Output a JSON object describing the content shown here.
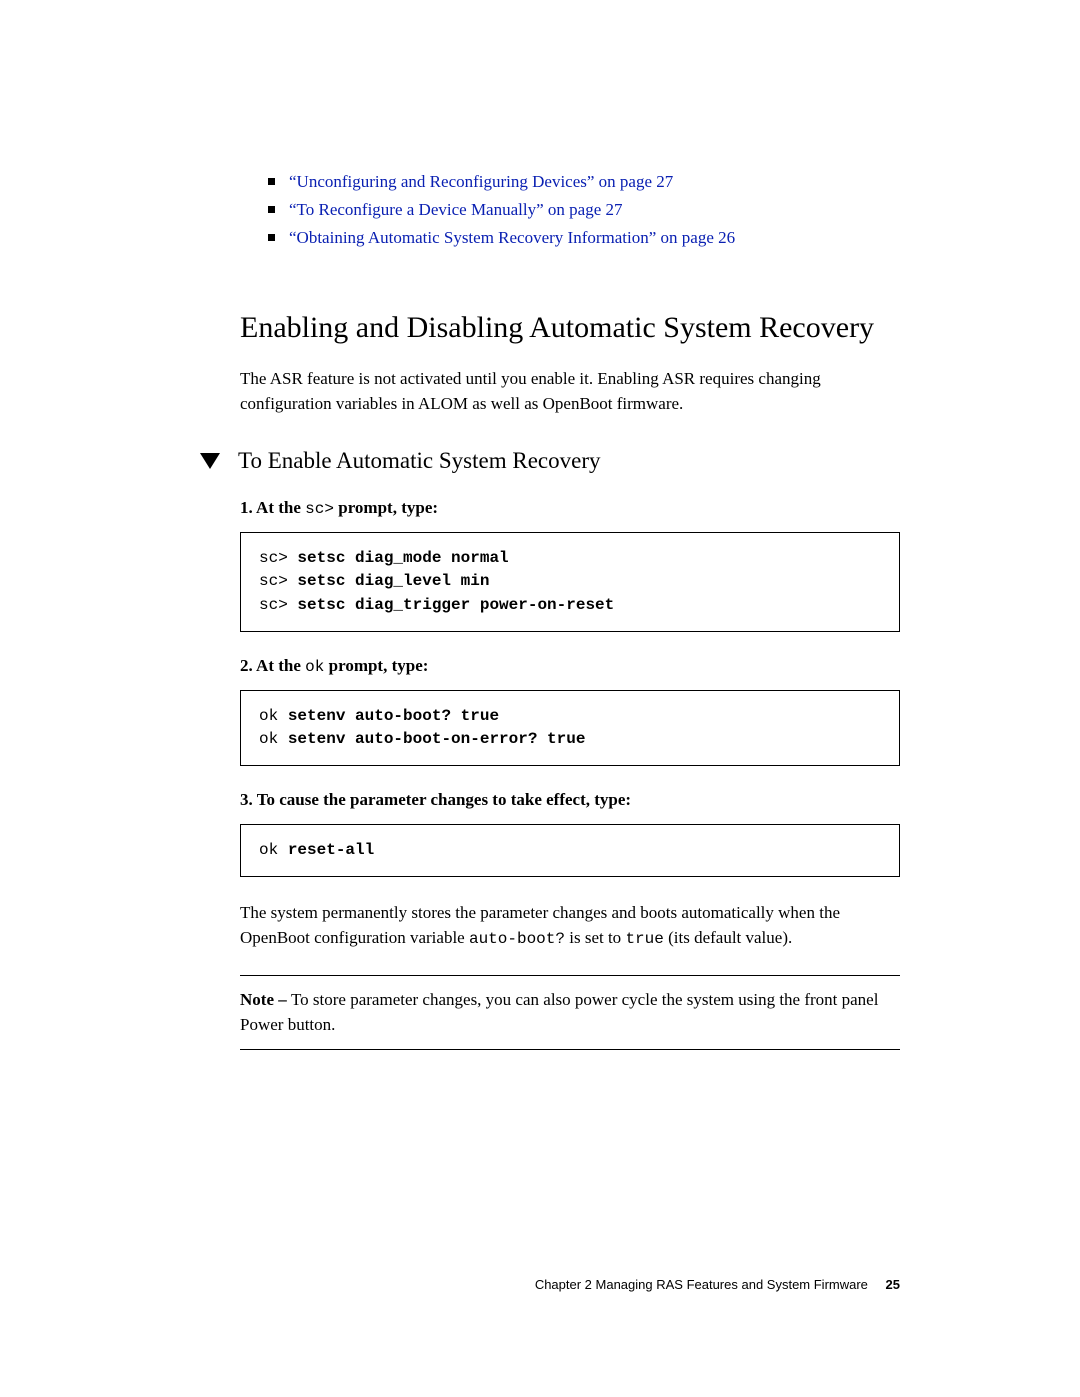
{
  "links": [
    {
      "text": "“Unconfiguring and Reconfiguring Devices” on page 27"
    },
    {
      "text": "“To Reconfigure a Device Manually” on page 27"
    },
    {
      "text": "“Obtaining Automatic System Recovery Information” on page 26"
    }
  ],
  "section": {
    "heading": "Enabling and Disabling Automatic System Recovery",
    "intro": "The ASR feature is not activated until you enable it. Enabling ASR requires changing configuration variables in ALOM as well as OpenBoot firmware."
  },
  "subsection": {
    "title": "To Enable Automatic System Recovery",
    "steps": [
      {
        "label_prefix": "1. At the ",
        "label_code": "sc>",
        "label_suffix": " prompt, type:",
        "lines": [
          {
            "prompt": "sc> ",
            "cmd": "setsc diag_mode normal"
          },
          {
            "prompt": "sc> ",
            "cmd": "setsc diag_level min"
          },
          {
            "prompt": "sc> ",
            "cmd": "setsc diag_trigger power-on-reset"
          }
        ]
      },
      {
        "label_prefix": "2. At the ",
        "label_code": "ok",
        "label_suffix": " prompt, type:",
        "lines": [
          {
            "prompt": "ok ",
            "cmd": "setenv auto-boot? true"
          },
          {
            "prompt": "ok ",
            "cmd": "setenv auto-boot-on-error? true"
          }
        ]
      },
      {
        "label_prefix": "3. To cause the parameter changes to take effect, type:",
        "label_code": "",
        "label_suffix": "",
        "lines": [
          {
            "prompt": "ok ",
            "cmd": "reset-all"
          }
        ]
      }
    ],
    "after_steps": {
      "p1_pre": "The system permanently stores the parameter changes and boots automatically when the OpenBoot configuration variable ",
      "p1_code1": "auto-boot?",
      "p1_mid": " is set to ",
      "p1_code2": "true",
      "p1_post": " (its default value)."
    },
    "note": {
      "label": "Note – ",
      "text": "To store parameter changes, you can also power cycle the system using the front panel Power button."
    }
  },
  "footer": {
    "chapter": "Chapter 2    Managing RAS Features and System Firmware",
    "page": "25"
  }
}
